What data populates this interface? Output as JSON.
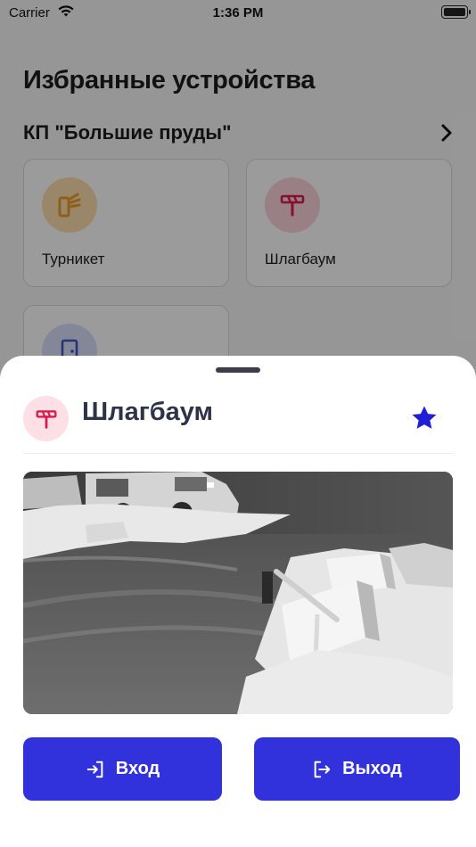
{
  "status_bar": {
    "carrier": "Carrier",
    "time": "1:36 PM",
    "wifi_icon": "wifi-icon",
    "battery_icon": "battery-icon"
  },
  "background_screen": {
    "title": "Избранные устройства",
    "section": {
      "title": "КП \"Большие пруды\"",
      "chevron_icon": "chevron-right-icon"
    },
    "devices": [
      {
        "label": "Турникет",
        "icon": "turnstile-icon",
        "icon_bg": "#f9d9a8",
        "icon_color": "#e69a2e"
      },
      {
        "label": "Шлагбаум",
        "icon": "barrier-icon",
        "icon_bg": "#f6cfd6",
        "icon_color": "#d81b4a"
      },
      {
        "label": "",
        "icon": "door-icon",
        "icon_bg": "#d5daf4",
        "icon_color": "#3d56b8"
      }
    ]
  },
  "bottom_sheet": {
    "title": "Шлагбаум",
    "icon": "barrier-icon",
    "favorite_icon": "star-icon",
    "favorite_active": true,
    "camera_feed": "camera-snapshot",
    "buttons": {
      "enter_label": "Вход",
      "exit_label": "Выход"
    }
  },
  "colors": {
    "accent": "#3232dc",
    "star": "#1f1fd6",
    "barrier_icon": "#d81b4a",
    "title_text": "#2e3448"
  }
}
